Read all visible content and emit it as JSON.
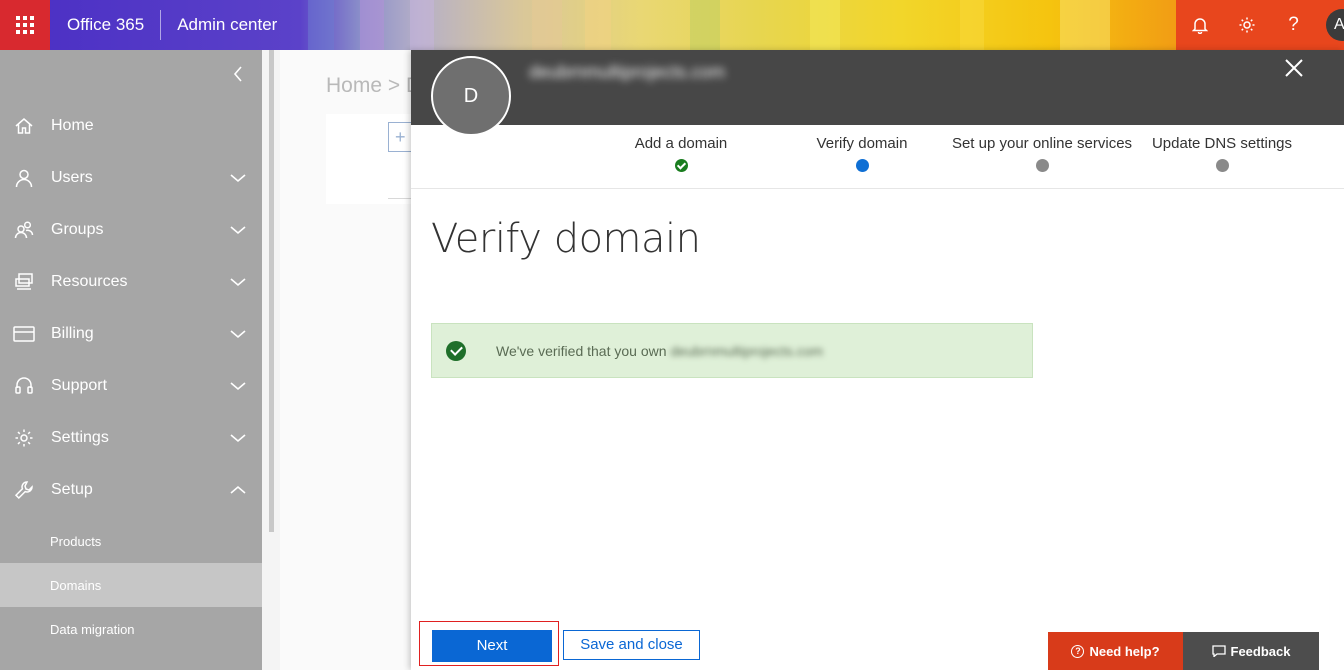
{
  "topbar": {
    "app_name": "Office 365",
    "section": "Admin center",
    "icons": [
      "waffle-icon",
      "bell-icon",
      "gear-icon",
      "help-icon"
    ],
    "help_glyph": "?",
    "avatar_initial": "A",
    "colors": {
      "waffle": "#d8292f",
      "right_area": "#e8461d"
    }
  },
  "sidebar": {
    "items": [
      {
        "label": "Home",
        "icon": "home-icon"
      },
      {
        "label": "Users",
        "icon": "user-icon",
        "expandable": true
      },
      {
        "label": "Groups",
        "icon": "groups-icon",
        "expandable": true
      },
      {
        "label": "Resources",
        "icon": "resources-icon",
        "expandable": true
      },
      {
        "label": "Billing",
        "icon": "billing-icon",
        "expandable": true
      },
      {
        "label": "Support",
        "icon": "headset-icon",
        "expandable": true
      },
      {
        "label": "Settings",
        "icon": "gear-icon",
        "expandable": true
      },
      {
        "label": "Setup",
        "icon": "wrench-icon",
        "expanded": true
      }
    ],
    "setup_children": [
      {
        "label": "Products"
      },
      {
        "label": "Domains",
        "active": true
      },
      {
        "label": "Data migration"
      }
    ],
    "colors": {
      "background": "#a6a6a6",
      "active_child": "#c6c6c6"
    }
  },
  "background_page": {
    "breadcrumb": "Home > D"
  },
  "panel": {
    "avatar_initial": "D",
    "domain_name": "deubrnmultiprojects.com",
    "steps": [
      {
        "label": "Add a domain",
        "state": "done"
      },
      {
        "label": "Verify domain",
        "state": "current"
      },
      {
        "label": "Set up your online services",
        "state": "pending"
      },
      {
        "label": "Update DNS settings",
        "state": "pending"
      }
    ],
    "title": "Verify domain",
    "alert": {
      "text": "We've verified that you own",
      "domain": "deubrnmultiprojects.com",
      "color": "#dff0d8"
    },
    "buttons": {
      "next": "Next",
      "save_close": "Save and close"
    },
    "help_bar": {
      "need_help": "Need help?",
      "feedback": "Feedback"
    },
    "colors": {
      "header": "#474747",
      "primary": "#0a67d4",
      "done": "#1a7d1f",
      "current": "#0f6fd4",
      "pending": "#8a8a8a"
    }
  }
}
